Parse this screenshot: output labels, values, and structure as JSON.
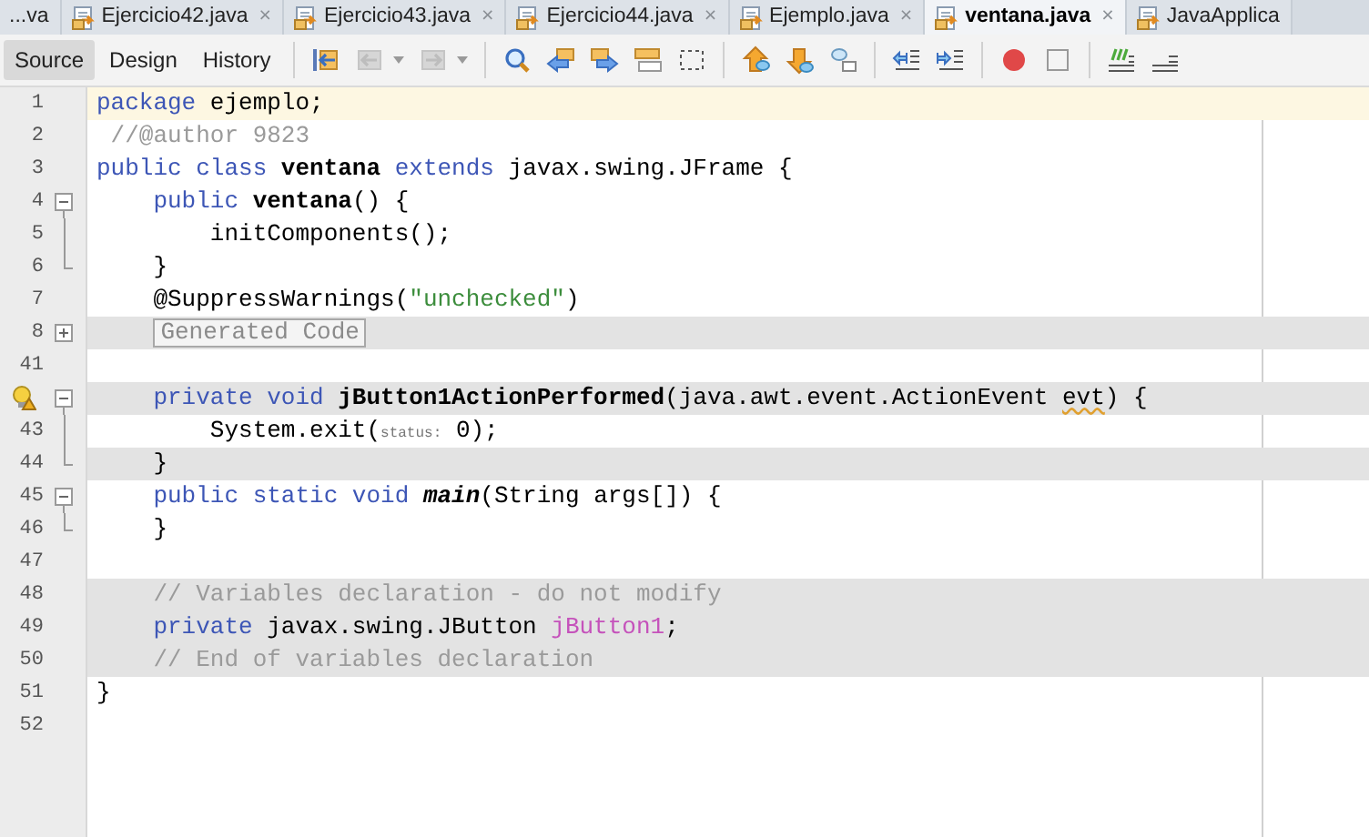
{
  "tabs": [
    {
      "label": "...va",
      "selected": false
    },
    {
      "label": "Ejercicio42.java",
      "selected": false,
      "icon": true,
      "close": "×"
    },
    {
      "label": "Ejercicio43.java",
      "selected": false,
      "icon": true,
      "close": "×"
    },
    {
      "label": "Ejercicio44.java",
      "selected": false,
      "icon": true,
      "close": "×"
    },
    {
      "label": "Ejemplo.java",
      "selected": false,
      "icon": true,
      "close": "×"
    },
    {
      "label": "ventana.java",
      "selected": true,
      "icon": true,
      "close": "×"
    },
    {
      "label": "JavaApplica",
      "selected": false,
      "icon": true
    }
  ],
  "views": [
    {
      "label": "Source",
      "selected": true
    },
    {
      "label": "Design",
      "selected": false
    },
    {
      "label": "History",
      "selected": false
    }
  ],
  "tool_groups": [
    [
      {
        "kind": "last-edit",
        "disabled": false
      },
      {
        "kind": "back",
        "disabled": true,
        "dropdown": true
      },
      {
        "kind": "forward",
        "disabled": true,
        "dropdown": true
      }
    ],
    [
      {
        "kind": "find",
        "disabled": false
      },
      {
        "kind": "find-prev",
        "disabled": false
      },
      {
        "kind": "find-next",
        "disabled": false
      },
      {
        "kind": "highlight",
        "disabled": false
      },
      {
        "kind": "rect-select",
        "disabled": false
      }
    ],
    [
      {
        "kind": "prev-bookmark",
        "disabled": false
      },
      {
        "kind": "next-bookmark",
        "disabled": false
      },
      {
        "kind": "toggle-bookmark",
        "disabled": false
      }
    ],
    [
      {
        "kind": "shift-left",
        "disabled": false
      },
      {
        "kind": "shift-right",
        "disabled": false
      }
    ],
    [
      {
        "kind": "record",
        "disabled": false
      },
      {
        "kind": "stop",
        "disabled": false
      }
    ],
    [
      {
        "kind": "comment",
        "disabled": false
      },
      {
        "kind": "uncomment",
        "disabled": false
      }
    ]
  ],
  "lines": [
    {
      "number": "1",
      "current": true,
      "tokens": [
        {
          "kind": "keyword",
          "text": "package"
        },
        {
          "kind": "plain",
          "text": " ejemplo;"
        }
      ]
    },
    {
      "number": "2",
      "tokens": [
        {
          "kind": "comment",
          "text": " //@author 9823"
        }
      ]
    },
    {
      "number": "3",
      "tokens": [
        {
          "kind": "keyword",
          "text": "public class"
        },
        {
          "kind": "declaration",
          "text": " ventana"
        },
        {
          "kind": "keyword",
          "text": " extends"
        },
        {
          "kind": "plain",
          "text": " javax.swing.JFrame {"
        }
      ]
    },
    {
      "number": "4",
      "fold": {
        "kind": "collapse"
      },
      "tokens": [
        {
          "kind": "keyword",
          "text": "    public"
        },
        {
          "kind": "declaration",
          "text": " ventana"
        },
        {
          "kind": "plain",
          "text": "() {"
        }
      ]
    },
    {
      "number": "5",
      "fold": {
        "kind": "line"
      },
      "tokens": [
        {
          "kind": "plain",
          "text": "        initComponents();"
        }
      ]
    },
    {
      "number": "6",
      "fold": {
        "kind": "end"
      },
      "tokens": [
        {
          "kind": "plain",
          "text": "    }"
        }
      ]
    },
    {
      "number": "7",
      "tokens": [
        {
          "kind": "plain",
          "text": "    @SuppressWarnings("
        },
        {
          "kind": "string",
          "text": "\"unchecked\""
        },
        {
          "kind": "plain",
          "text": ")"
        }
      ]
    },
    {
      "number": "8",
      "fold": {
        "kind": "expand"
      },
      "highlighted": true,
      "tokens": [
        {
          "kind": "folded",
          "text": "Generated Code"
        }
      ]
    },
    {
      "number": "41"
    },
    {
      "warning": true,
      "fold": {
        "kind": "collapse"
      },
      "highlighted": true,
      "tokens": [
        {
          "kind": "keyword",
          "text": "    private void"
        },
        {
          "kind": "declaration",
          "text": " jButton1ActionPerformed"
        },
        {
          "kind": "plain",
          "text": "(java.awt.event.ActionEvent "
        },
        {
          "kind": "warned",
          "text": "evt"
        },
        {
          "kind": "plain",
          "text": ") {"
        }
      ]
    },
    {
      "number": "43",
      "fold": {
        "kind": "line"
      },
      "tokens": [
        {
          "kind": "plain",
          "text": "        System.exit("
        },
        {
          "kind": "hint",
          "text": "status:"
        },
        {
          "kind": "plain",
          "text": " 0);"
        }
      ]
    },
    {
      "number": "44",
      "fold": {
        "kind": "end"
      },
      "highlighted": true,
      "tokens": [
        {
          "kind": "plain",
          "text": "    }"
        }
      ]
    },
    {
      "number": "45",
      "fold": {
        "kind": "collapse"
      },
      "tokens": [
        {
          "kind": "keyword",
          "text": "    public static void"
        },
        {
          "kind": "static-declaration",
          "text": " main"
        },
        {
          "kind": "plain",
          "text": "(String args[]) {"
        }
      ]
    },
    {
      "number": "46",
      "fold": {
        "kind": "end"
      },
      "tokens": [
        {
          "kind": "plain",
          "text": "    }"
        }
      ]
    },
    {
      "number": "47"
    },
    {
      "number": "48",
      "highlighted": true,
      "tokens": [
        {
          "kind": "comment",
          "text": "    // Variables declaration - do not modify"
        }
      ]
    },
    {
      "number": "49",
      "highlighted": true,
      "tokens": [
        {
          "kind": "keyword",
          "text": "    private"
        },
        {
          "kind": "plain",
          "text": " javax.swing.JButton "
        },
        {
          "kind": "field",
          "text": "jButton1"
        },
        {
          "kind": "plain",
          "text": ";"
        }
      ]
    },
    {
      "number": "50",
      "highlighted": true,
      "tokens": [
        {
          "kind": "comment",
          "text": "    // End of variables declaration"
        }
      ]
    },
    {
      "number": "51",
      "tokens": [
        {
          "kind": "plain",
          "text": "}"
        }
      ]
    },
    {
      "number": "52"
    }
  ]
}
